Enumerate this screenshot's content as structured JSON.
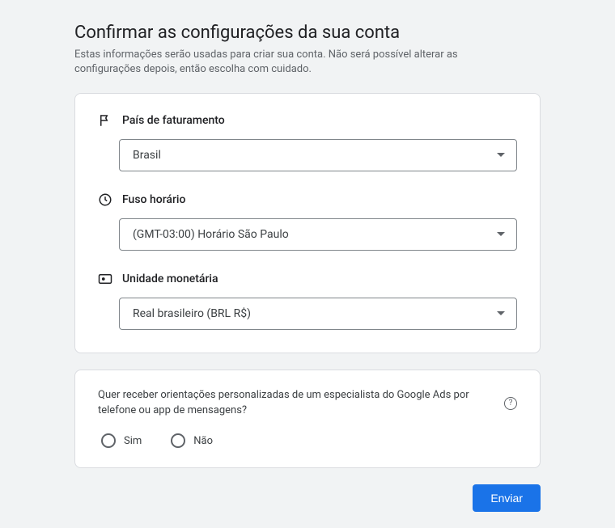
{
  "header": {
    "title": "Confirmar as configurações da sua conta",
    "subtitle": "Estas informações serão usadas para criar sua conta. Não será possível alterar as configurações depois, então escolha com cuidado."
  },
  "fields": {
    "country": {
      "label": "País de faturamento",
      "value": "Brasil"
    },
    "timezone": {
      "label": "Fuso horário",
      "value": "(GMT-03:00) Horário São Paulo"
    },
    "currency": {
      "label": "Unidade monetária",
      "value": "Real brasileiro (BRL R$)"
    }
  },
  "optin": {
    "question": "Quer receber orientações personalizadas de um especialista do Google Ads por telefone ou app de mensagens?",
    "yes": "Sim",
    "no": "Não"
  },
  "actions": {
    "submit": "Enviar"
  }
}
